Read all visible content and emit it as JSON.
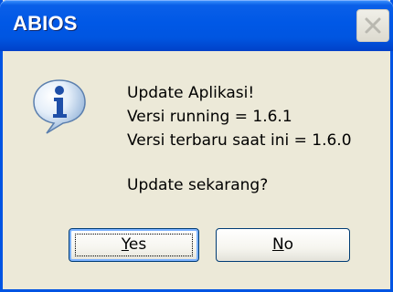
{
  "window": {
    "title": "ABIOS",
    "close_icon": "close-icon",
    "colors": {
      "titlebar": "#0058e6",
      "body": "#ece9d8",
      "button_border": "#003c74"
    }
  },
  "dialog": {
    "icon": "info-icon",
    "message_lines": [
      "Update Aplikasi!",
      "Versi running = 1.6.1",
      "Versi terbaru saat ini = 1.6.0"
    ],
    "question": "Update sekarang?"
  },
  "buttons": {
    "yes": {
      "mnemonic": "Y",
      "rest": "es"
    },
    "no": {
      "mnemonic": "N",
      "rest": "o"
    }
  }
}
